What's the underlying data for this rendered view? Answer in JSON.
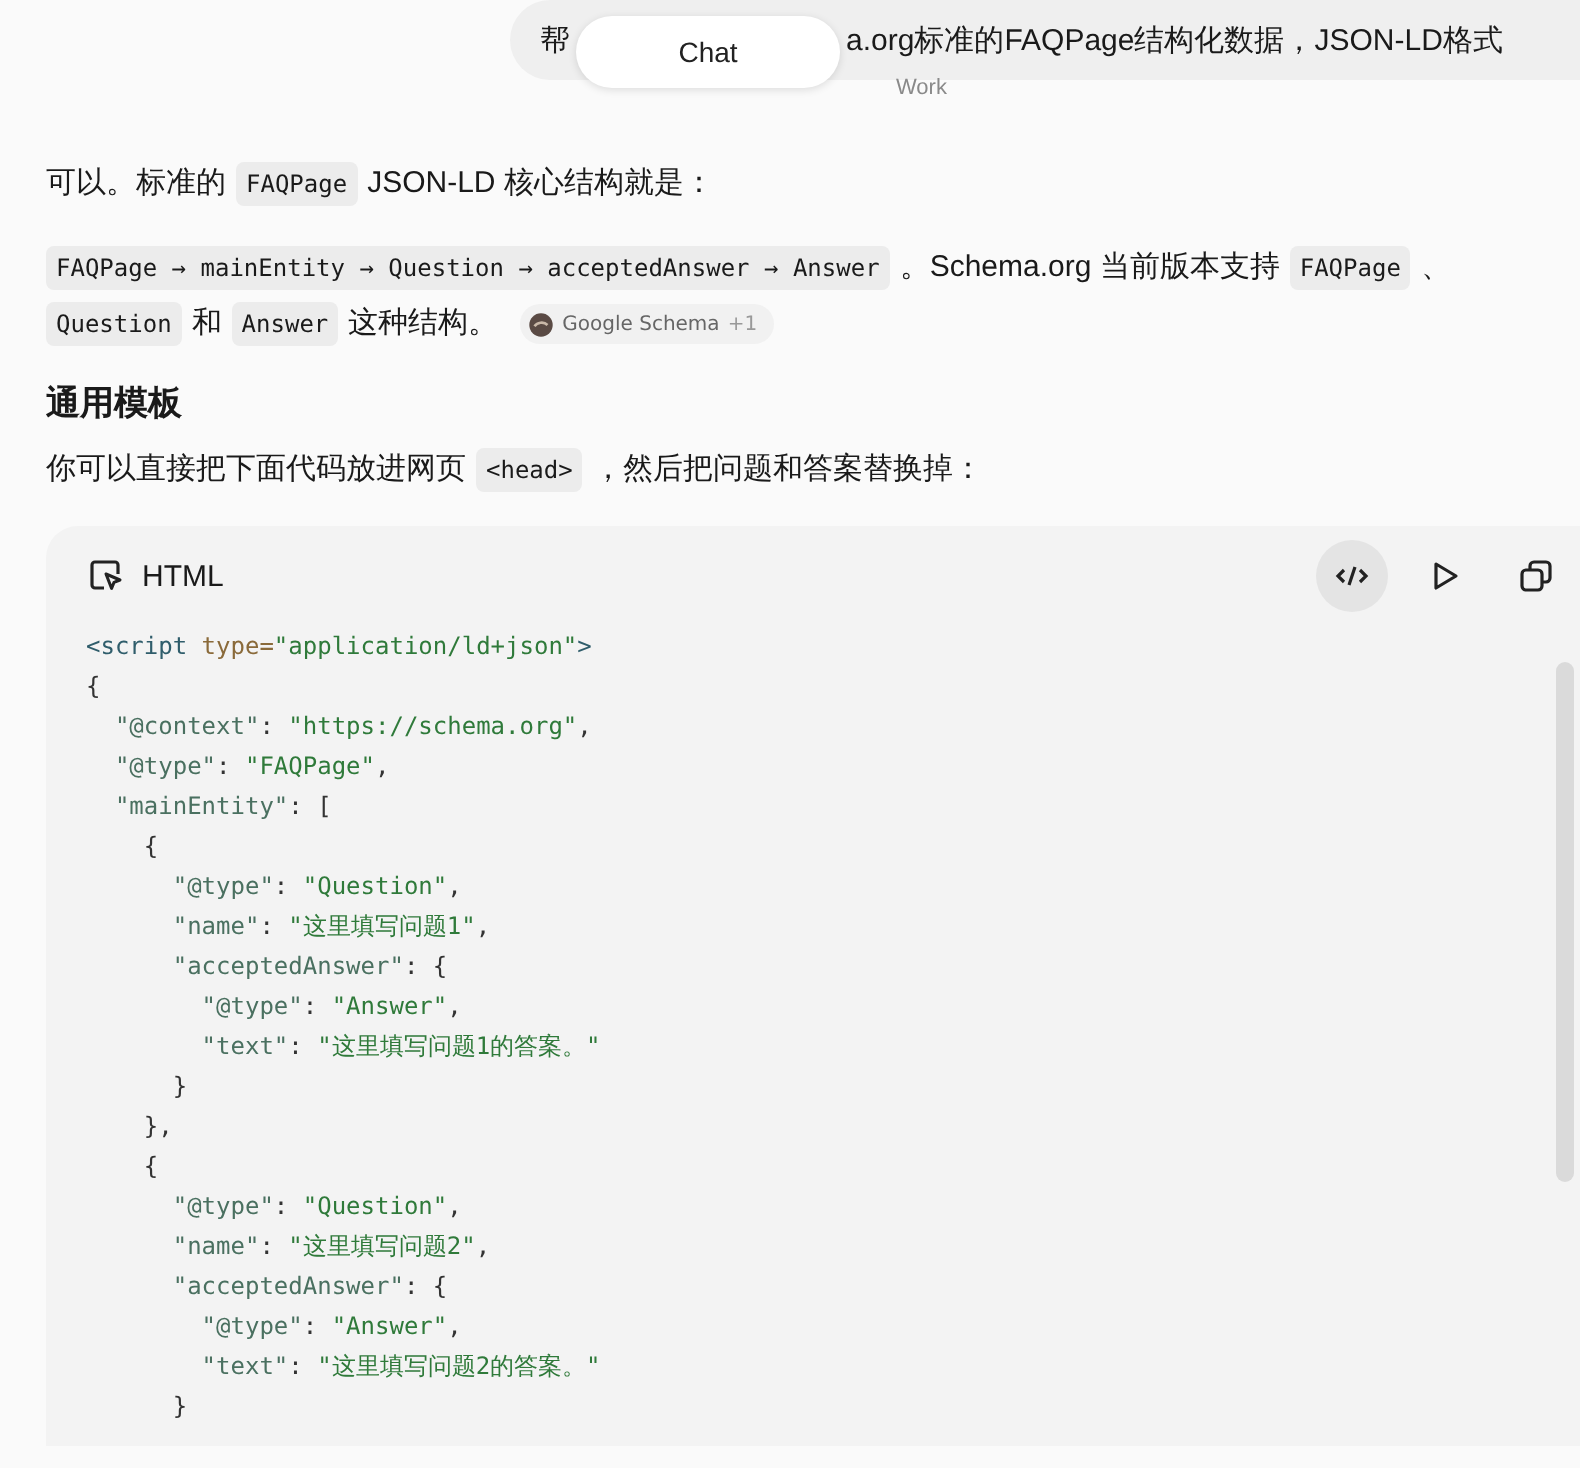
{
  "user_message": {
    "parts": [
      "帮",
      "a.org标准的FAQPage结构化数据，JSON-LD格式"
    ]
  },
  "mode_tabs": [
    {
      "label": "Chat",
      "selected": true
    },
    {
      "label": "Work",
      "selected": false
    }
  ],
  "blocks": [
    {
      "kind": "paragraph",
      "segments": [
        {
          "kind": "text",
          "text": "可以。标准的"
        },
        {
          "kind": "code",
          "text": "FAQPage"
        },
        {
          "kind": "text",
          "text": "JSON-LD 核心结构就是："
        }
      ]
    },
    {
      "kind": "paragraph",
      "segments": [
        {
          "kind": "code",
          "text": "FAQPage → mainEntity → Question → acceptedAnswer → Answer"
        },
        {
          "kind": "text",
          "text": "。Schema.org 当前版本支持"
        },
        {
          "kind": "code",
          "text": "FAQPage"
        },
        {
          "kind": "text",
          "text": "、"
        },
        {
          "kind": "code",
          "text": "Question"
        },
        {
          "kind": "text",
          "text": "和"
        },
        {
          "kind": "code",
          "text": "Answer"
        },
        {
          "kind": "text",
          "text": "这种结构。"
        },
        {
          "kind": "citation",
          "text": "Google Schema",
          "extra": "+1"
        }
      ]
    },
    {
      "kind": "heading",
      "text": "通用模板"
    },
    {
      "kind": "paragraph",
      "segments": [
        {
          "kind": "text",
          "text": "你可以直接把下面代码放进网页"
        },
        {
          "kind": "code",
          "text": "<head>"
        },
        {
          "kind": "text",
          "text": "，然后把问题和答案替换掉："
        }
      ]
    },
    {
      "kind": "code_block",
      "language": "HTML",
      "lines": [
        [
          {
            "kind": "tag",
            "text": "<script "
          },
          {
            "kind": "attr",
            "text": "type="
          },
          {
            "kind": "str",
            "text": "\"application/ld+json\""
          },
          {
            "kind": "tag",
            "text": ">"
          }
        ],
        [
          {
            "kind": "punct",
            "text": "{"
          }
        ],
        [
          {
            "kind": "key",
            "text": "  \"@context\""
          },
          {
            "kind": "punct",
            "text": ": "
          },
          {
            "kind": "str",
            "text": "\"https://schema.org\""
          },
          {
            "kind": "punct",
            "text": ","
          }
        ],
        [
          {
            "kind": "key",
            "text": "  \"@type\""
          },
          {
            "kind": "punct",
            "text": ": "
          },
          {
            "kind": "str",
            "text": "\"FAQPage\""
          },
          {
            "kind": "punct",
            "text": ","
          }
        ],
        [
          {
            "kind": "key",
            "text": "  \"mainEntity\""
          },
          {
            "kind": "punct",
            "text": ": ["
          }
        ],
        [
          {
            "kind": "punct",
            "text": "    {"
          }
        ],
        [
          {
            "kind": "key",
            "text": "      \"@type\""
          },
          {
            "kind": "punct",
            "text": ": "
          },
          {
            "kind": "str",
            "text": "\"Question\""
          },
          {
            "kind": "punct",
            "text": ","
          }
        ],
        [
          {
            "kind": "key",
            "text": "      \"name\""
          },
          {
            "kind": "punct",
            "text": ": "
          },
          {
            "kind": "str",
            "text": "\"这里填写问题1\""
          },
          {
            "kind": "punct",
            "text": ","
          }
        ],
        [
          {
            "kind": "key",
            "text": "      \"acceptedAnswer\""
          },
          {
            "kind": "punct",
            "text": ": {"
          }
        ],
        [
          {
            "kind": "key",
            "text": "        \"@type\""
          },
          {
            "kind": "punct",
            "text": ": "
          },
          {
            "kind": "str",
            "text": "\"Answer\""
          },
          {
            "kind": "punct",
            "text": ","
          }
        ],
        [
          {
            "kind": "key",
            "text": "        \"text\""
          },
          {
            "kind": "punct",
            "text": ": "
          },
          {
            "kind": "str",
            "text": "\"这里填写问题1的答案。\""
          }
        ],
        [
          {
            "kind": "punct",
            "text": "      }"
          }
        ],
        [
          {
            "kind": "punct",
            "text": "    },"
          }
        ],
        [
          {
            "kind": "punct",
            "text": "    {"
          }
        ],
        [
          {
            "kind": "key",
            "text": "      \"@type\""
          },
          {
            "kind": "punct",
            "text": ": "
          },
          {
            "kind": "str",
            "text": "\"Question\""
          },
          {
            "kind": "punct",
            "text": ","
          }
        ],
        [
          {
            "kind": "key",
            "text": "      \"name\""
          },
          {
            "kind": "punct",
            "text": ": "
          },
          {
            "kind": "str",
            "text": "\"这里填写问题2\""
          },
          {
            "kind": "punct",
            "text": ","
          }
        ],
        [
          {
            "kind": "key",
            "text": "      \"acceptedAnswer\""
          },
          {
            "kind": "punct",
            "text": ": {"
          }
        ],
        [
          {
            "kind": "key",
            "text": "        \"@type\""
          },
          {
            "kind": "punct",
            "text": ": "
          },
          {
            "kind": "str",
            "text": "\"Answer\""
          },
          {
            "kind": "punct",
            "text": ","
          }
        ],
        [
          {
            "kind": "key",
            "text": "        \"text\""
          },
          {
            "kind": "punct",
            "text": ": "
          },
          {
            "kind": "str",
            "text": "\"这里填写问题2的答案。\""
          }
        ],
        [
          {
            "kind": "punct",
            "text": "      }"
          }
        ]
      ]
    }
  ]
}
